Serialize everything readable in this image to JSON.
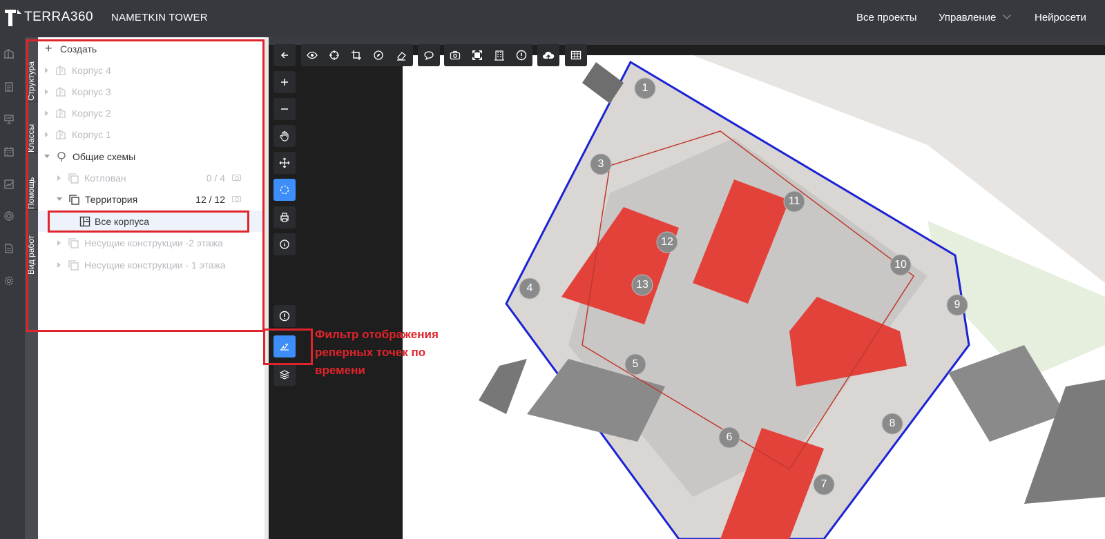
{
  "app": {
    "logo_text": "TERRA360",
    "project_title": "NAMETKIN TOWER"
  },
  "nav": {
    "items": [
      {
        "label": "Все проекты"
      },
      {
        "label": "Управление",
        "has_dropdown": true
      },
      {
        "label": "Нейросети"
      }
    ]
  },
  "rail": {
    "icons": [
      "building-icon",
      "document-icon",
      "presentation-icon",
      "calendar-icon",
      "chart-icon",
      "settings-ring-icon",
      "report-icon",
      "gear-icon"
    ]
  },
  "vertical_tabs": [
    {
      "label": "Структура"
    },
    {
      "label": "Классы"
    },
    {
      "label": "Помощь"
    },
    {
      "label": "Вид работ"
    }
  ],
  "panel": {
    "create_label": "Создать",
    "tree": [
      {
        "label": "Корпус 4",
        "icon": "building-icon",
        "dim": true
      },
      {
        "label": "Корпус 3",
        "icon": "building-icon",
        "dim": true
      },
      {
        "label": "Корпус 2",
        "icon": "building-icon",
        "dim": true
      },
      {
        "label": "Корпус 1",
        "icon": "building-icon",
        "dim": true
      },
      {
        "label": "Общие схемы",
        "icon": "balloon-icon",
        "dim": false,
        "expanded": true
      },
      {
        "label": "Котлован",
        "icon": "layers-icon",
        "dim": true,
        "count": "0 / 4"
      },
      {
        "label": "Территория",
        "icon": "layers-icon",
        "dim": false,
        "expanded": true,
        "count": "12 / 12"
      },
      {
        "label": "Все корпуса",
        "icon": "plan-icon",
        "dim": false,
        "selected": true
      },
      {
        "label": "Несущие конструкции -2 этажа",
        "icon": "layers-icon",
        "dim": true
      },
      {
        "label": "Несущие конструкции - 1 этажа",
        "icon": "layers-icon",
        "dim": true
      }
    ]
  },
  "annotation": {
    "text": "Фильтр отображения реперных точек по времени"
  },
  "plan": {
    "markers": [
      "1",
      "3",
      "4",
      "5",
      "6",
      "7",
      "8",
      "9",
      "10",
      "11",
      "12",
      "13"
    ]
  },
  "colors": {
    "accent": "#3d8ef8",
    "highlight": "#e0242b",
    "topbar": "#37393f",
    "building_red": "#e3423a"
  }
}
